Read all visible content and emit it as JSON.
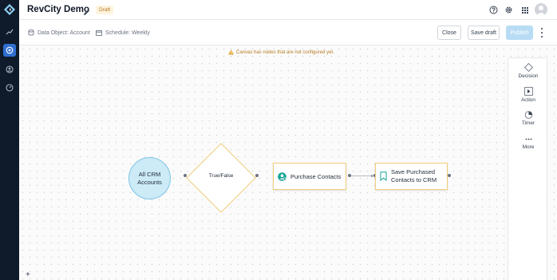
{
  "header": {
    "title": "RevCity Demo",
    "status_badge": "Draft"
  },
  "toolbar": {
    "data_object": "Data Object: Account",
    "schedule": "Schedule: Weekly",
    "close_label": "Close",
    "save_draft_label": "Save draft",
    "publish_label": "Publish"
  },
  "canvas": {
    "warning": "Canvas has nodes that are not configured yet.",
    "nodes": {
      "start_line1": "All CRM",
      "start_line2": "Accounts",
      "decision": "True/False",
      "action1": "Purchase Contacts",
      "action2_line1": "Save Purchased",
      "action2_line2": "Contacts to CRM"
    }
  },
  "palette": {
    "items": [
      {
        "label": "Decision",
        "icon": "diamond-icon"
      },
      {
        "label": "Action",
        "icon": "play-icon"
      },
      {
        "label": "Timer",
        "icon": "timer-icon"
      },
      {
        "label": "More",
        "icon": "ellipsis-icon"
      }
    ]
  },
  "colors": {
    "rail_bg": "#0f1a2b",
    "rail_active": "#2f6fd1",
    "node_border": "#f2cc7a",
    "start_fill": "#cdeaf7",
    "publish_bg": "#b9dcf5",
    "badge_text": "#b7791f"
  }
}
